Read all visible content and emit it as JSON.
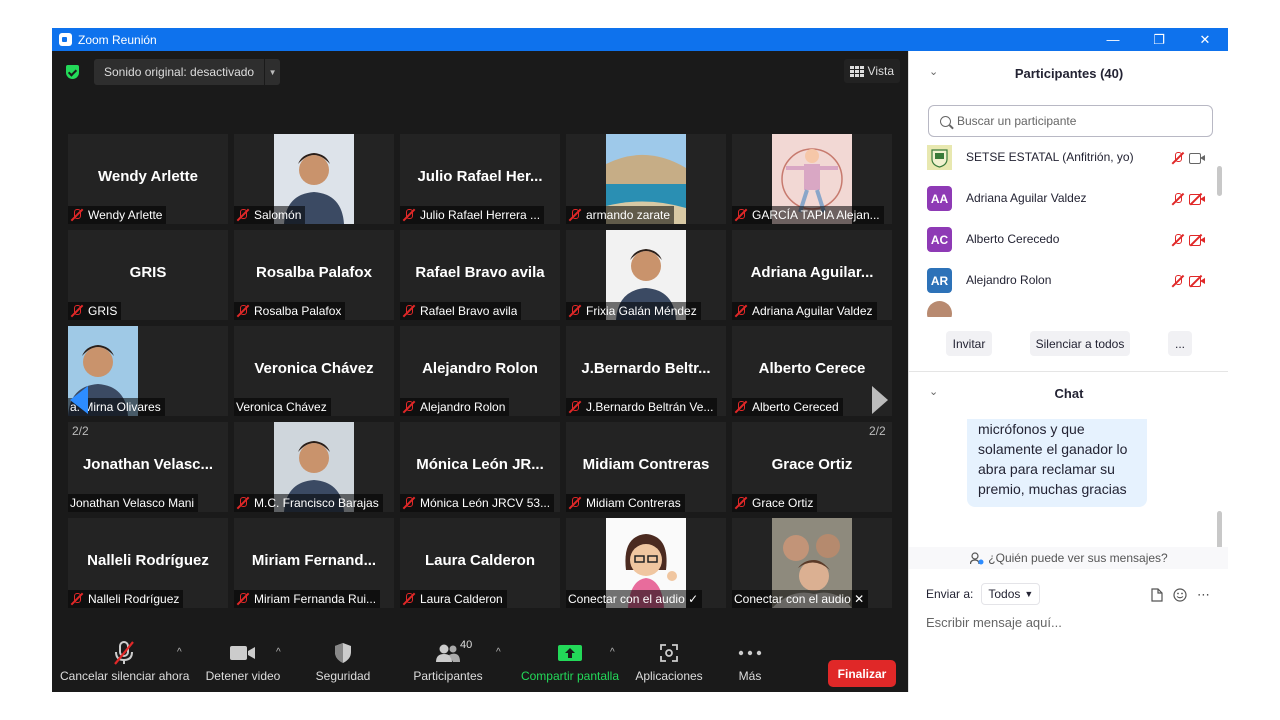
{
  "window": {
    "title": "Zoom Reunión"
  },
  "topbar": {
    "sound_label": "Sonido original: desactivado",
    "view_label": "Vista"
  },
  "pages": {
    "left": "2/2",
    "right": "2/2"
  },
  "tiles": [
    {
      "big": "Wendy  Arlette",
      "name": "Wendy  Arlette",
      "muted": true
    },
    {
      "big": "",
      "name": "Salomón",
      "muted": true,
      "photo": "person",
      "pbg": "#dde3ea"
    },
    {
      "big": "Julio  Rafael  Her...",
      "name": "Julio Rafael Herrera ...",
      "muted": true
    },
    {
      "big": "",
      "name": "armando zarate",
      "muted": true,
      "photo": "beach"
    },
    {
      "big": "",
      "name": "GARCÍA TAPIA Alejan...",
      "muted": true,
      "photo": "drawing"
    },
    {
      "big": "GRIS",
      "name": "GRIS",
      "muted": true
    },
    {
      "big": "Rosalba Palafox",
      "name": "Rosalba Palafox",
      "muted": true
    },
    {
      "big": "Rafael Bravo avila",
      "name": "Rafael Bravo avila",
      "muted": true
    },
    {
      "big": "",
      "name": "Frixia Galán Méndez",
      "muted": true,
      "photo": "person",
      "pbg": "#f2f2f2"
    },
    {
      "big": "Adriana  Aguilar...",
      "name": "Adriana Aguilar Valdez",
      "muted": true
    },
    {
      "big": "",
      "name": "a. Mirna Olivares",
      "muted": false,
      "photo": "person",
      "pbg": "#9fc9e6",
      "off": -50
    },
    {
      "big": "Veronica Chávez",
      "name": "Veronica Chávez",
      "muted": false
    },
    {
      "big": "Alejandro Rolon",
      "name": "Alejandro Rolon",
      "muted": true
    },
    {
      "big": "J.Bernardo  Beltr...",
      "name": "J.Bernardo Beltrán Ve...",
      "muted": true
    },
    {
      "big": "Alberto Cerece",
      "name": "Alberto Cereced",
      "muted": true
    },
    {
      "big": "Jonathan  Velasc...",
      "name": "Jonathan Velasco Mani",
      "muted": false
    },
    {
      "big": "",
      "name": "M.C. Francisco Barajas",
      "muted": true,
      "photo": "person",
      "pbg": "#cfd6dc"
    },
    {
      "big": "Mónica León JR...",
      "name": "Mónica León JRCV 53...",
      "muted": true
    },
    {
      "big": "Midiam Contreras",
      "name": "Midiam Contreras",
      "muted": true
    },
    {
      "big": "Grace Ortiz",
      "name": "Grace Ortiz",
      "muted": true
    },
    {
      "big": "Nalleli Rodríguez",
      "name": "Nalleli Rodríguez",
      "muted": true
    },
    {
      "big": "Miriam  Fernand...",
      "name": "Miriam Fernanda Rui...",
      "muted": true
    },
    {
      "big": "Laura Calderon",
      "name": "Laura Calderon",
      "muted": true
    },
    {
      "big": "",
      "name": "Conectar con el audio ✓",
      "muted": false,
      "photo": "avatar"
    },
    {
      "big": "",
      "name": "Conectar con el audio ✕",
      "muted": false,
      "photo": "family"
    }
  ],
  "toolbar": {
    "mute": "Cancelar silenciar ahora",
    "video": "Detener video",
    "security": "Seguridad",
    "participants": "Participantes",
    "participants_count": "40",
    "share": "Compartir pantalla",
    "apps": "Aplicaciones",
    "more": "Más",
    "end": "Finalizar"
  },
  "panel": {
    "participants_title": "Participantes (40)",
    "search_placeholder": "Buscar un participante",
    "participants": [
      {
        "initials": "",
        "name": "SETSE ESTATAL (Anfitrión, yo)",
        "color": "#e8e8b0",
        "cam_on": true
      },
      {
        "initials": "AA",
        "name": "Adriana Aguilar Valdez",
        "color": "#8e3ab5",
        "cam_on": false
      },
      {
        "initials": "AC",
        "name": "Alberto Cerecedo",
        "color": "#8e3ab5",
        "cam_on": false
      },
      {
        "initials": "AR",
        "name": "Alejandro Rolon",
        "color": "#2d72b8",
        "cam_on": false
      }
    ],
    "invite": "Invitar",
    "mute_all": "Silenciar a todos",
    "more": "...",
    "chat_title": "Chat",
    "chat_message": "apagados sus micrófonos y que solamente el ganador lo abra para reclamar su premio, muchas gracias",
    "who_can_see": "¿Quién puede ver sus mensajes?",
    "send_to_label": "Enviar a:",
    "send_to_value": "Todos",
    "message_placeholder": "Escribir mensaje aquí..."
  }
}
